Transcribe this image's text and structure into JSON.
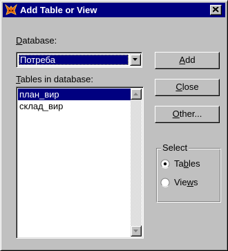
{
  "window": {
    "title": "Add Table or View",
    "icon": "fox-icon",
    "close_icon": "close-icon"
  },
  "database": {
    "label_mnemonic": "D",
    "label_rest": "atabase:",
    "selected": "Потреба"
  },
  "tables": {
    "label_mnemonic": "T",
    "label_rest": "ables in database:",
    "items": [
      "план_вир",
      "склад_вир"
    ],
    "selected_index": 0
  },
  "buttons": {
    "add": {
      "mnemonic": "A",
      "rest": "dd"
    },
    "close": {
      "mnemonic": "C",
      "rest": "lose"
    },
    "other": {
      "mnemonic": "O",
      "rest": "ther..."
    }
  },
  "select_group": {
    "label": "Select",
    "options": [
      {
        "pre": "Ta",
        "mnemonic": "b",
        "post": "les",
        "checked": true
      },
      {
        "pre": "Vie",
        "mnemonic": "w",
        "post": "s",
        "checked": false
      }
    ]
  },
  "colors": {
    "titlebar": "#000080",
    "face": "#c0c0c0",
    "selection": "#000080"
  }
}
